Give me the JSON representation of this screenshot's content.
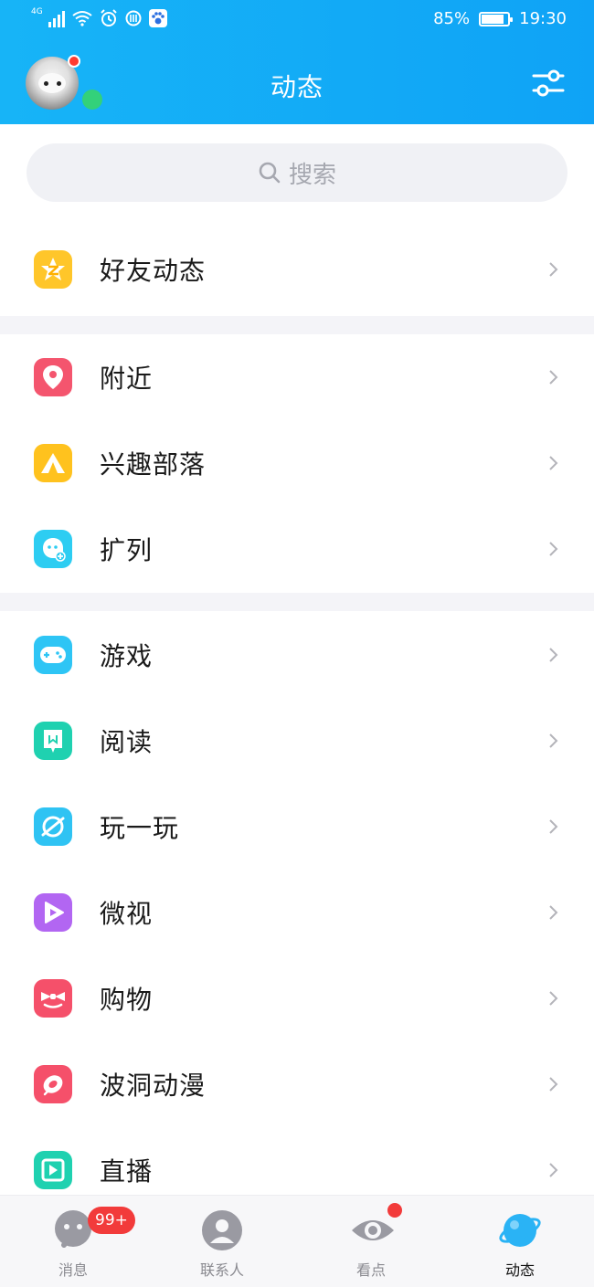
{
  "status_bar": {
    "network": "4G",
    "battery": "85%",
    "time": "19:30"
  },
  "header": {
    "title": "动态"
  },
  "search": {
    "placeholder": "搜索"
  },
  "groups": [
    {
      "items": [
        {
          "label": "好友动态",
          "icon": "qzone-star-icon",
          "color": "#ffc62a"
        }
      ]
    },
    {
      "items": [
        {
          "label": "附近",
          "icon": "location-pin-icon",
          "color": "#f4556e"
        },
        {
          "label": "兴趣部落",
          "icon": "tent-icon",
          "color": "#ffc21e"
        },
        {
          "label": "扩列",
          "icon": "add-friend-icon",
          "color": "#2dcdf2"
        }
      ]
    },
    {
      "items": [
        {
          "label": "游戏",
          "icon": "gamepad-icon",
          "color": "#2ec5f5"
        },
        {
          "label": "阅读",
          "icon": "book-icon",
          "color": "#1fd1b0"
        },
        {
          "label": "玩一玩",
          "icon": "planet-icon",
          "color": "#2fc3f3"
        },
        {
          "label": "微视",
          "icon": "play-icon",
          "color": "#b266f2"
        },
        {
          "label": "购物",
          "icon": "bow-icon",
          "color": "#f5506a"
        },
        {
          "label": "波洞动漫",
          "icon": "comic-icon",
          "color": "#f5506a"
        },
        {
          "label": "直播",
          "icon": "live-icon",
          "color": "#1fd1b0"
        }
      ]
    }
  ],
  "tabbar": {
    "tabs": [
      {
        "label": "消息",
        "badge": "99+"
      },
      {
        "label": "联系人"
      },
      {
        "label": "看点"
      },
      {
        "label": "动态"
      }
    ]
  }
}
